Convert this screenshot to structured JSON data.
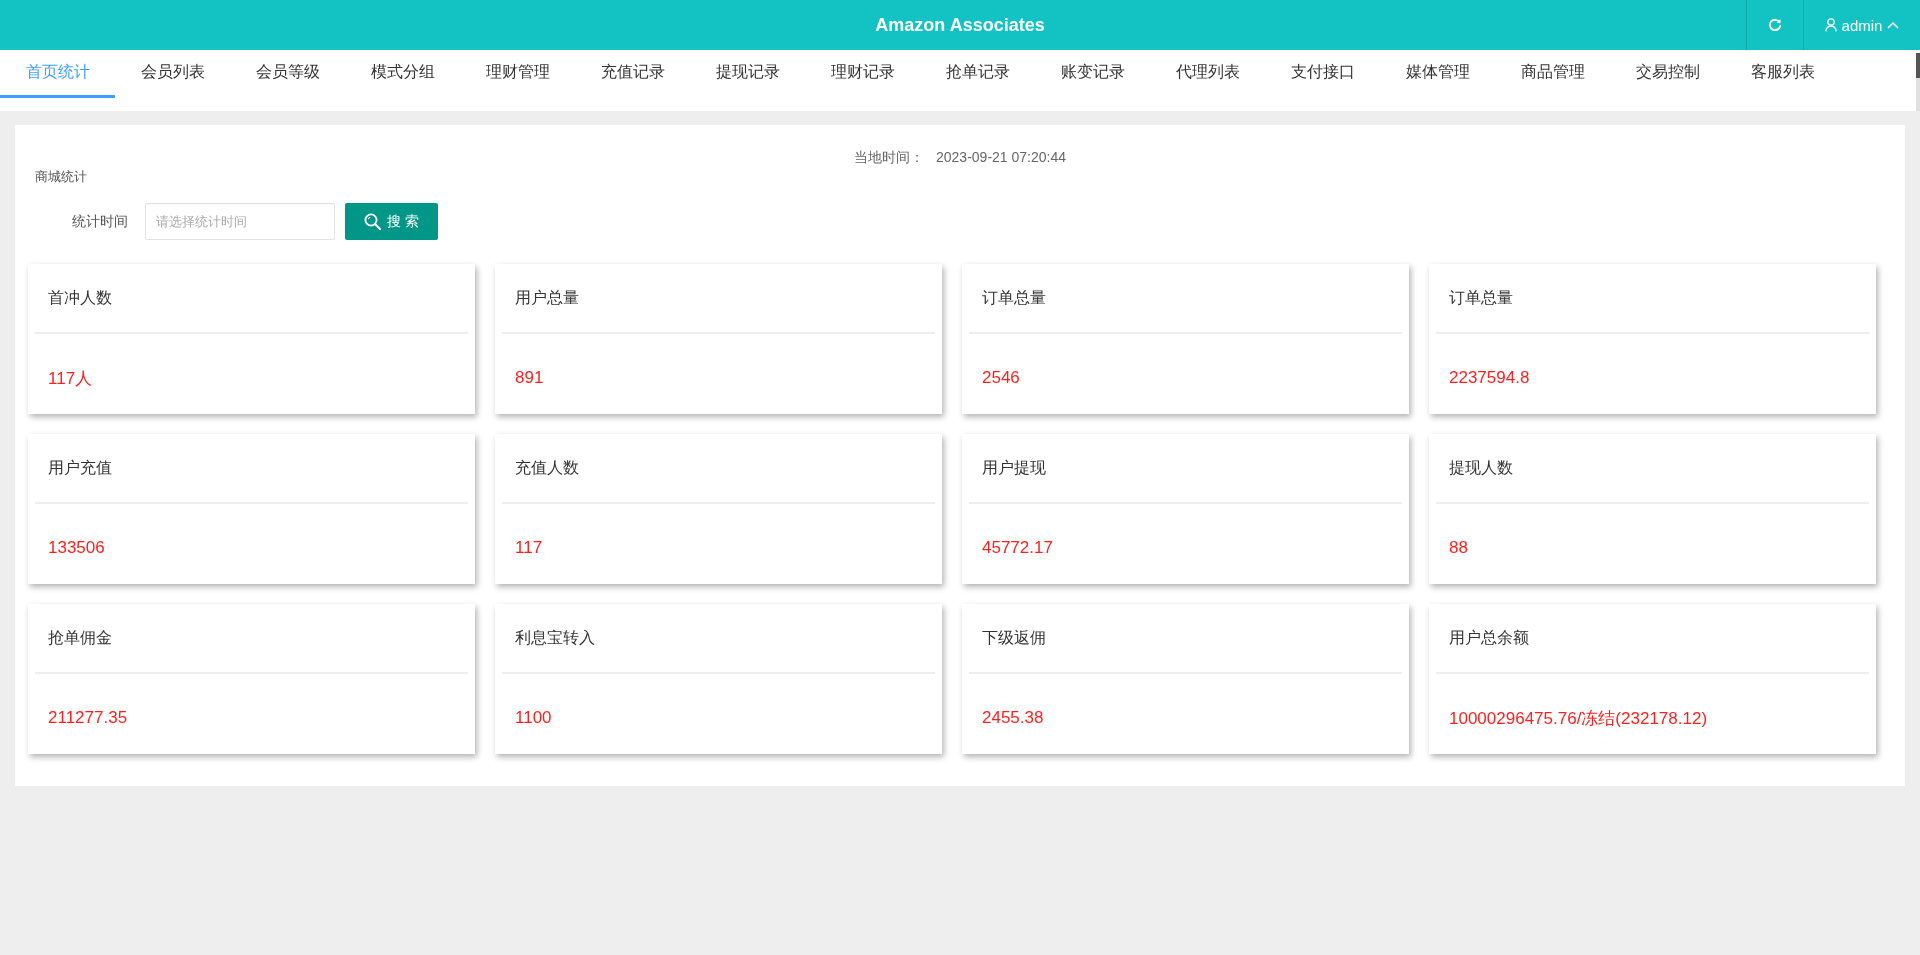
{
  "header": {
    "title": "Amazon Associates",
    "user": "admin"
  },
  "tabs": [
    {
      "label": "首页统计",
      "selected": true
    },
    {
      "label": "会员列表",
      "selected": false
    },
    {
      "label": "会员等级",
      "selected": false
    },
    {
      "label": "模式分组",
      "selected": false
    },
    {
      "label": "理财管理",
      "selected": false
    },
    {
      "label": "充值记录",
      "selected": false
    },
    {
      "label": "提现记录",
      "selected": false
    },
    {
      "label": "理财记录",
      "selected": false
    },
    {
      "label": "抢单记录",
      "selected": false
    },
    {
      "label": "账变记录",
      "selected": false
    },
    {
      "label": "代理列表",
      "selected": false
    },
    {
      "label": "支付接口",
      "selected": false
    },
    {
      "label": "媒体管理",
      "selected": false
    },
    {
      "label": "商品管理",
      "selected": false
    },
    {
      "label": "交易控制",
      "selected": false
    },
    {
      "label": "客服列表",
      "selected": false
    }
  ],
  "panel": {
    "time_label": "当地时间：",
    "time_value": "2023-09-21 07:20:44",
    "section_title": "商城统计",
    "filter": {
      "label": "统计时间",
      "placeholder": "请选择统计时间",
      "button": "搜 索"
    }
  },
  "stats": [
    {
      "title": "首冲人数",
      "value": "117人"
    },
    {
      "title": "用户总量",
      "value": "891"
    },
    {
      "title": "订单总量",
      "value": "2546"
    },
    {
      "title": "订单总量",
      "value": "2237594.8"
    },
    {
      "title": "用户充值",
      "value": "133506"
    },
    {
      "title": "充值人数",
      "value": "117"
    },
    {
      "title": "用户提现",
      "value": "45772.17"
    },
    {
      "title": "提现人数",
      "value": "88"
    },
    {
      "title": "抢单佣金",
      "value": "211277.35"
    },
    {
      "title": "利息宝转入",
      "value": "1100"
    },
    {
      "title": "下级返佣",
      "value": "2455.38"
    },
    {
      "title": "用户总余额",
      "value": "10000296475.76/冻结(232178.12)"
    }
  ]
}
